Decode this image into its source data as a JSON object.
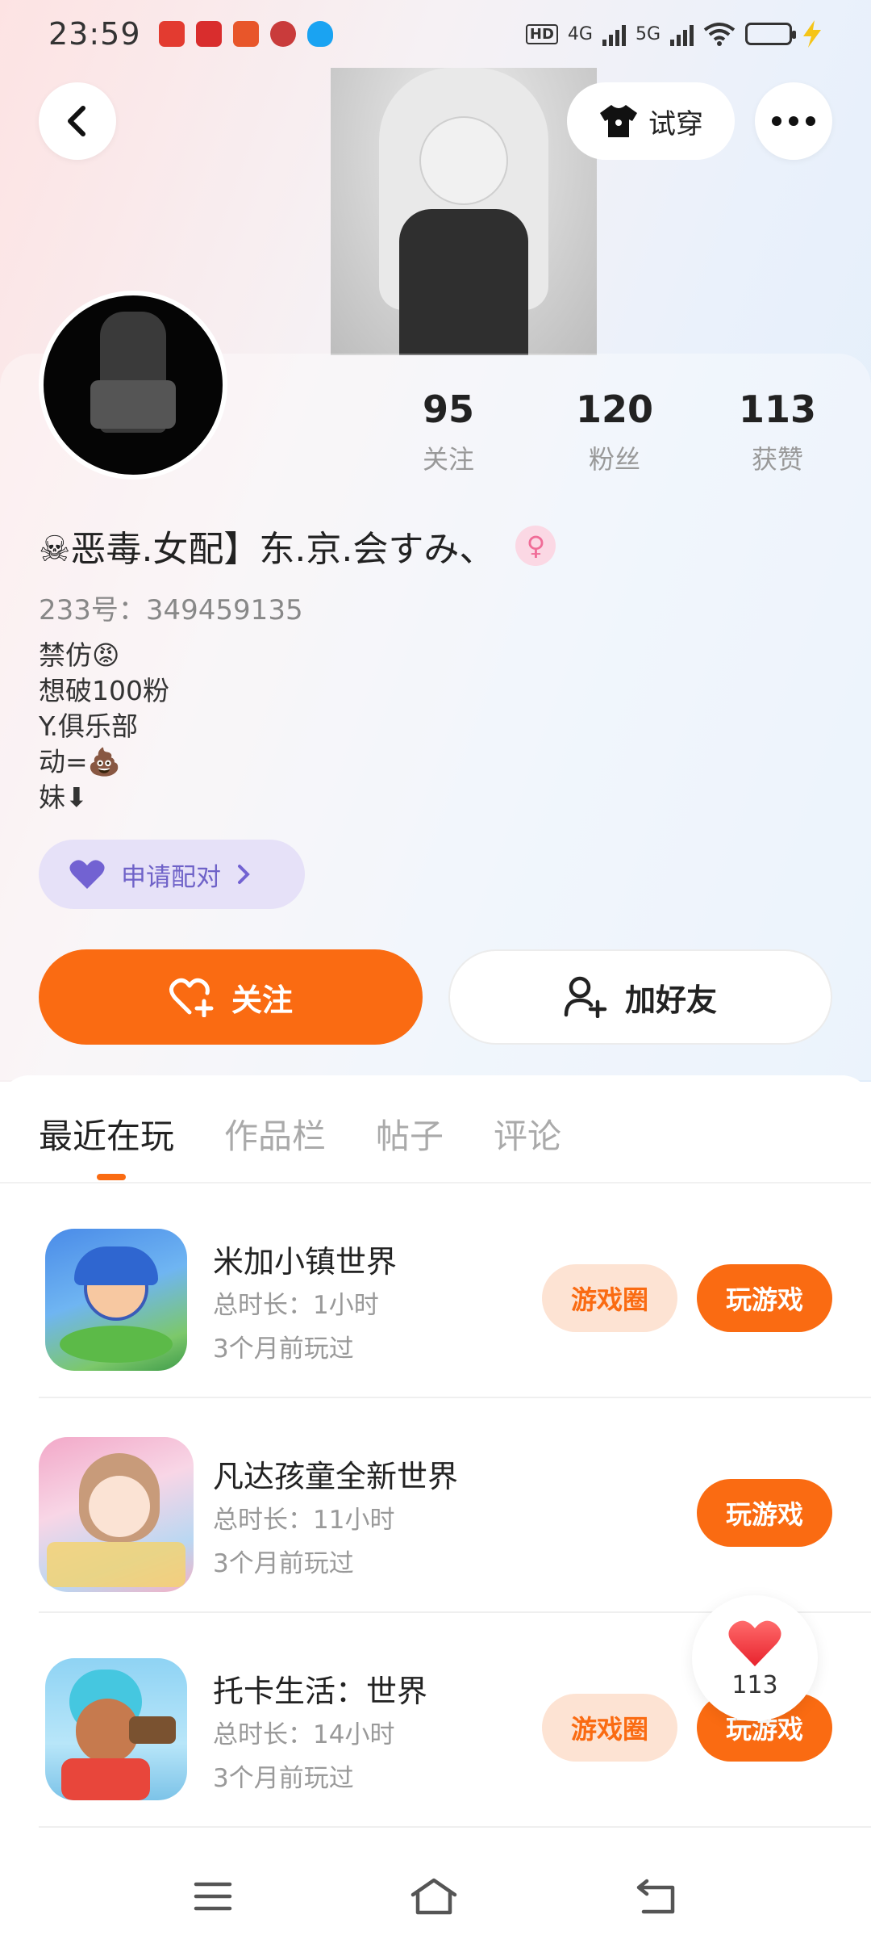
{
  "status_bar": {
    "time": "23:59",
    "network_1": "4G",
    "network_2": "5G",
    "hd": "HD"
  },
  "header": {
    "back_icon": "chevron-left-icon",
    "tryon_label": "试穿",
    "more_icon": "more-icon"
  },
  "profile": {
    "stats": [
      {
        "value": "95",
        "label": "关注"
      },
      {
        "value": "120",
        "label": "粉丝"
      },
      {
        "value": "113",
        "label": "获赞"
      }
    ],
    "nickname": "☠恶毒.女配】东.京.会すみ、",
    "gender": "♀",
    "uid": "233号：349459135",
    "bio_lines": [
      "禁仿😡",
      "想破100粉",
      "Y.俱乐部",
      "动=💩",
      "妹⬇"
    ],
    "pair_label": "申请配对",
    "follow_label": "关注",
    "friend_label": "加好友"
  },
  "tabs": [
    {
      "label": "最近在玩",
      "active": true
    },
    {
      "label": "作品栏",
      "active": false
    },
    {
      "label": "帖子",
      "active": false
    },
    {
      "label": "评论",
      "active": false
    }
  ],
  "games": [
    {
      "title": "米加小镇世界",
      "duration": "总时长：1小时",
      "last_played": "3个月前玩过",
      "circle_label": "游戏圈",
      "play_label": "玩游戏"
    },
    {
      "title": "凡达孩童全新世界",
      "duration": "总时长：11小时",
      "last_played": "3个月前玩过",
      "circle_label": "",
      "play_label": "玩游戏"
    },
    {
      "title": "托卡生活：世界",
      "duration": "总时长：14小时",
      "last_played": "3个月前玩过",
      "circle_label": "游戏圈",
      "play_label": "玩游戏"
    }
  ],
  "like_float": {
    "count": "113"
  },
  "colors": {
    "accent": "#fa6b12",
    "pair_bg": "#e6e1f8",
    "pair_text": "#6f62c8"
  }
}
